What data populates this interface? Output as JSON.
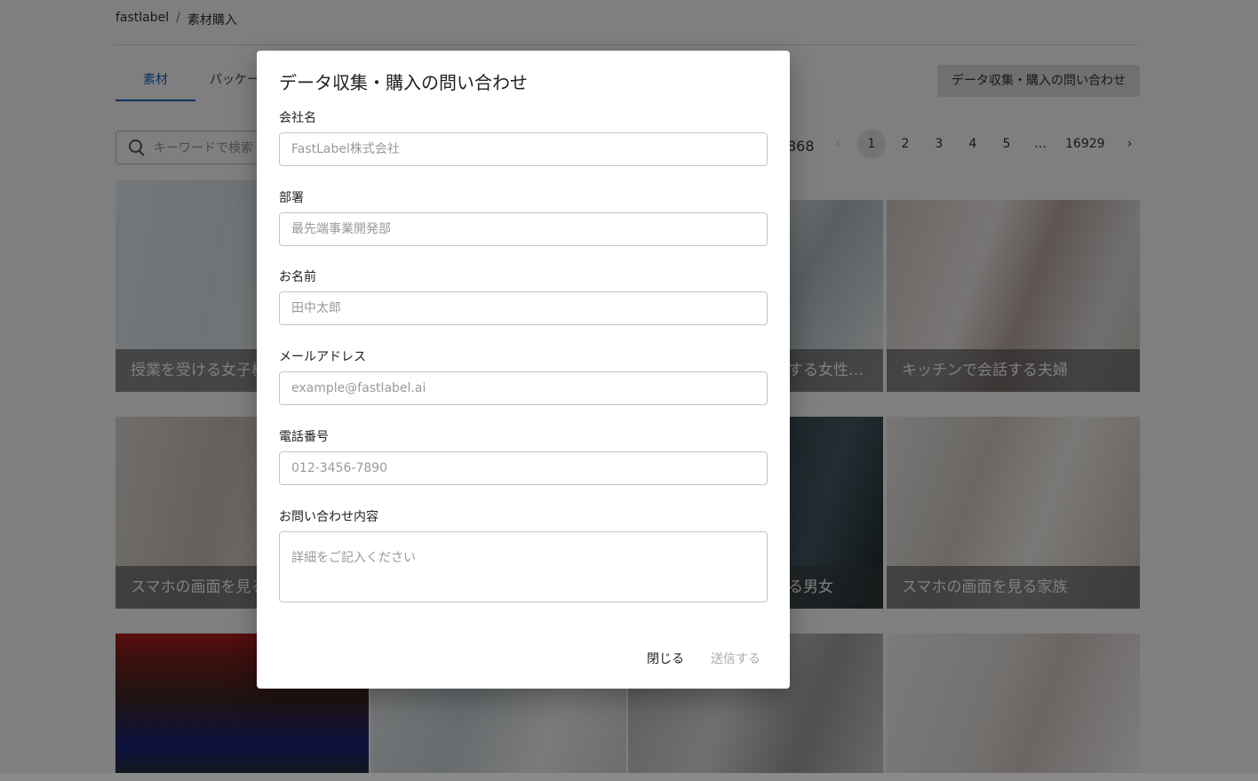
{
  "breadcrumb": {
    "root": "fastlabel",
    "sep": "/",
    "current": "素材購入"
  },
  "tabs": [
    {
      "label": "素材",
      "active": true
    },
    {
      "label": "パッケー"
    }
  ],
  "top_button": "データ収集・購入の問い合わせ",
  "search": {
    "placeholder": "キーワードで検索"
  },
  "total_count_fragment": "868",
  "pagination": {
    "prev": "‹",
    "pages": [
      "1",
      "2",
      "3",
      "4",
      "5"
    ],
    "ellipsis": "…",
    "last": "16929",
    "next": "›",
    "current": "1"
  },
  "cards": [
    {
      "caption": "授業を受ける女子校"
    },
    {
      "caption": "する女性…"
    },
    {
      "caption": "キッチンで会話する夫婦"
    },
    {
      "caption": "スマホの画面を見る"
    },
    {
      "caption": "る男女"
    },
    {
      "caption": "スマホの画面を見る家族"
    }
  ],
  "modal": {
    "title": "データ収集・購入の問い合わせ",
    "fields": {
      "company": {
        "label": "会社名",
        "placeholder": "FastLabel株式会社"
      },
      "department": {
        "label": "部署",
        "placeholder": "最先端事業開発部"
      },
      "name": {
        "label": "お名前",
        "placeholder": "田中太郎"
      },
      "email": {
        "label": "メールアドレス",
        "placeholder": "example@fastlabel.ai"
      },
      "phone": {
        "label": "電話番号",
        "placeholder": "012-3456-7890"
      },
      "inquiry": {
        "label": "お問い合わせ内容",
        "placeholder": "詳細をご記入ください"
      }
    },
    "close_label": "閉じる",
    "submit_label": "送信する"
  }
}
